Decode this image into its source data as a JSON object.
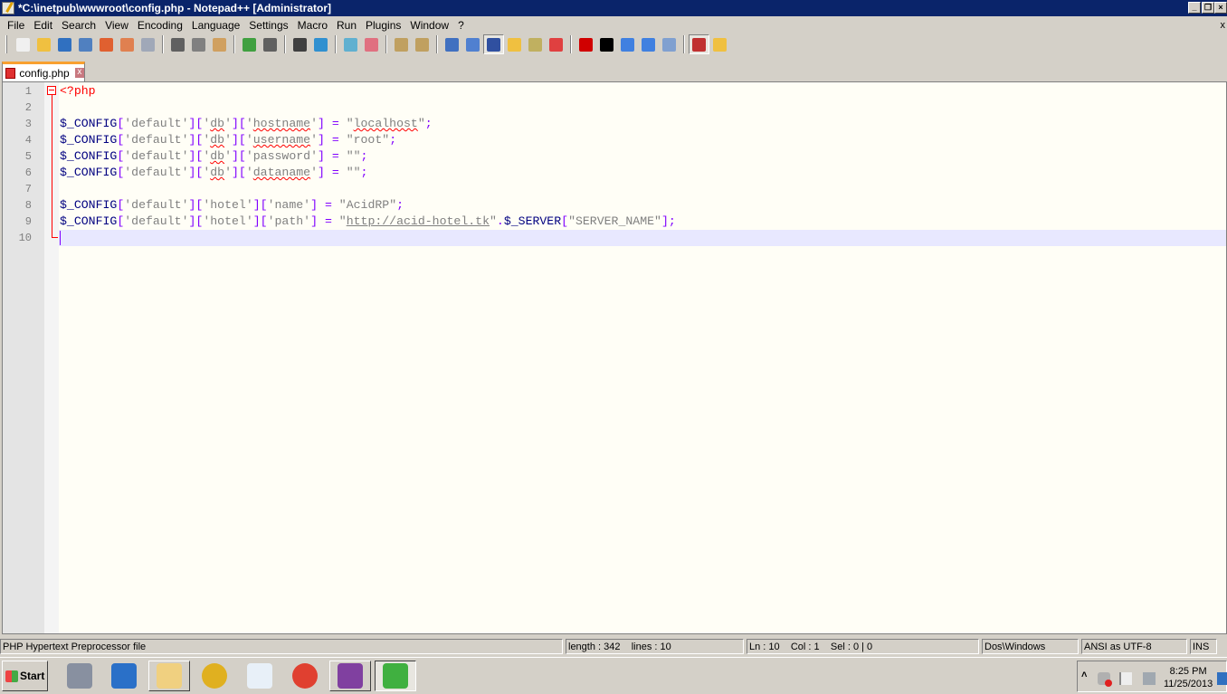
{
  "window": {
    "title": "*C:\\inetpub\\wwwroot\\config.php - Notepad++ [Administrator]"
  },
  "menu": [
    "File",
    "Edit",
    "Search",
    "View",
    "Encoding",
    "Language",
    "Settings",
    "Macro",
    "Run",
    "Plugins",
    "Window",
    "?"
  ],
  "menu_close": "x",
  "toolbar": [
    {
      "name": "new-file-icon",
      "color": "#f0f0f0"
    },
    {
      "name": "open-file-icon",
      "color": "#f0c040"
    },
    {
      "name": "save-icon",
      "color": "#3070c0"
    },
    {
      "name": "save-all-icon",
      "color": "#5080c0"
    },
    {
      "name": "close-icon",
      "color": "#e06030"
    },
    {
      "name": "close-all-icon",
      "color": "#e08050"
    },
    {
      "name": "print-icon",
      "color": "#a0a8b8"
    },
    "sep",
    {
      "name": "cut-icon",
      "color": "#606060"
    },
    {
      "name": "copy-icon",
      "color": "#808080"
    },
    {
      "name": "paste-icon",
      "color": "#d0a060"
    },
    "sep",
    {
      "name": "undo-icon",
      "color": "#40a040"
    },
    {
      "name": "redo-icon",
      "color": "#606060"
    },
    "sep",
    {
      "name": "find-icon",
      "color": "#404040"
    },
    {
      "name": "replace-icon",
      "color": "#3090d0"
    },
    "sep",
    {
      "name": "zoom-in-icon",
      "color": "#60b0d0"
    },
    {
      "name": "zoom-out-icon",
      "color": "#e07080"
    },
    "sep",
    {
      "name": "sync-vertical-icon",
      "color": "#c0a060"
    },
    {
      "name": "sync-horizontal-icon",
      "color": "#c0a060"
    },
    "sep",
    {
      "name": "word-wrap-icon",
      "color": "#4070c0"
    },
    {
      "name": "show-all-chars-icon",
      "color": "#5080d0"
    },
    {
      "name": "indent-guide-icon",
      "color": "#3050a0",
      "active": true
    },
    {
      "name": "user-language-icon",
      "color": "#f0c040"
    },
    {
      "name": "doc-map-icon",
      "color": "#c0b060"
    },
    {
      "name": "function-list-icon",
      "color": "#e04040"
    },
    "sep",
    {
      "name": "record-macro-icon",
      "color": "#d00000"
    },
    {
      "name": "stop-macro-icon",
      "color": "#000000"
    },
    {
      "name": "play-macro-icon",
      "color": "#4080e0"
    },
    {
      "name": "run-macro-multiple-icon",
      "color": "#4080e0"
    },
    {
      "name": "save-macro-icon",
      "color": "#80a0d0"
    },
    "sep",
    {
      "name": "spell-check-icon",
      "color": "#c03030",
      "active": true
    },
    {
      "name": "folder-link-icon",
      "color": "#f0c040"
    }
  ],
  "tab": {
    "label": "config.php",
    "close": "x"
  },
  "editor": {
    "lines": [
      "<?php",
      "",
      "$_CONFIG['default']['db']['hostname'] = \"localhost\";",
      "$_CONFIG['default']['db']['username'] = \"root\";",
      "$_CONFIG['default']['db']['password'] = \"\";",
      "$_CONFIG['default']['db']['dataname'] = \"\";",
      "",
      "$_CONFIG['default']['hotel']['name'] = \"AcidRP\";",
      "$_CONFIG['default']['hotel']['path'] = \"http://acid-hotel.tk\".$_SERVER[\"SERVER_NAME\"];",
      ""
    ],
    "current_line": 10,
    "spell_errors": [
      "db",
      "hostname",
      "localhost",
      "username",
      "dataname"
    ]
  },
  "status": {
    "file_type": "PHP Hypertext Preprocessor file",
    "length": "length : 342    lines : 10",
    "position": "Ln : 10    Col : 1    Sel : 0 | 0",
    "eol": "Dos\\Windows",
    "encoding": "ANSI as UTF-8",
    "mode": "INS"
  },
  "taskbar": {
    "start": "Start",
    "items": [
      {
        "name": "server-manager-icon",
        "color": "#8890a0"
      },
      {
        "name": "powershell-icon",
        "color": "#2a70c8"
      },
      {
        "name": "explorer-icon",
        "color": "#f0d080",
        "button": true
      },
      {
        "name": "xampp-icon",
        "color": "#e0b020"
      },
      {
        "name": "atom-app-icon",
        "color": "#e8f0f8"
      },
      {
        "name": "chrome-icon",
        "color": "#e04030"
      },
      {
        "name": "winrar-icon",
        "color": "#8040a0",
        "button": true
      },
      {
        "name": "notepadpp-icon",
        "color": "#40b040",
        "button": true,
        "active": true
      }
    ]
  },
  "tray": {
    "time": "8:25 PM",
    "date": "11/25/2013",
    "expand": "˄"
  }
}
